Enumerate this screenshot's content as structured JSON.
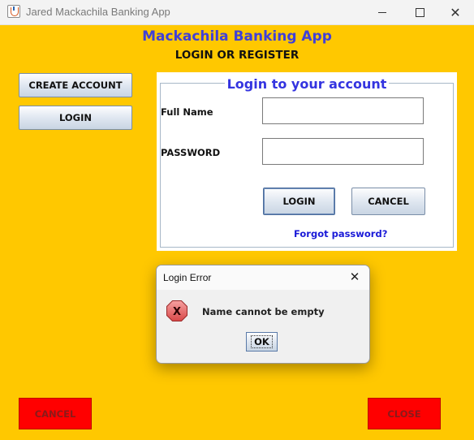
{
  "window": {
    "title": "Jared Mackachila Banking App",
    "minimize_icon": "minimize-icon",
    "maximize_icon": "maximize-icon",
    "close_icon": "close-icon"
  },
  "header": {
    "app_name": "Mackachila Banking App",
    "subtitle": "LOGIN OR REGISTER"
  },
  "side_menu": {
    "create_account_label": "CREATE ACCOUNT",
    "login_label": "LOGIN"
  },
  "login_panel": {
    "title": "Login to your account",
    "full_name_label": "Full Name",
    "full_name_value": "",
    "password_label": "PASSWORD",
    "password_value": "",
    "login_button": "LOGIN",
    "cancel_button": "CANCEL",
    "forgot_password": "Forgot password?"
  },
  "footer": {
    "cancel_label": "CANCEL",
    "close_label": "CLOSE"
  },
  "dialog": {
    "title": "Login Error",
    "message": "Name cannot be empty",
    "ok_label": "OK",
    "icon": "error-icon"
  },
  "colors": {
    "background": "#ffc800",
    "heading": "#4040d8",
    "footer_button": "#ff0000",
    "link": "#1a1ad8"
  }
}
